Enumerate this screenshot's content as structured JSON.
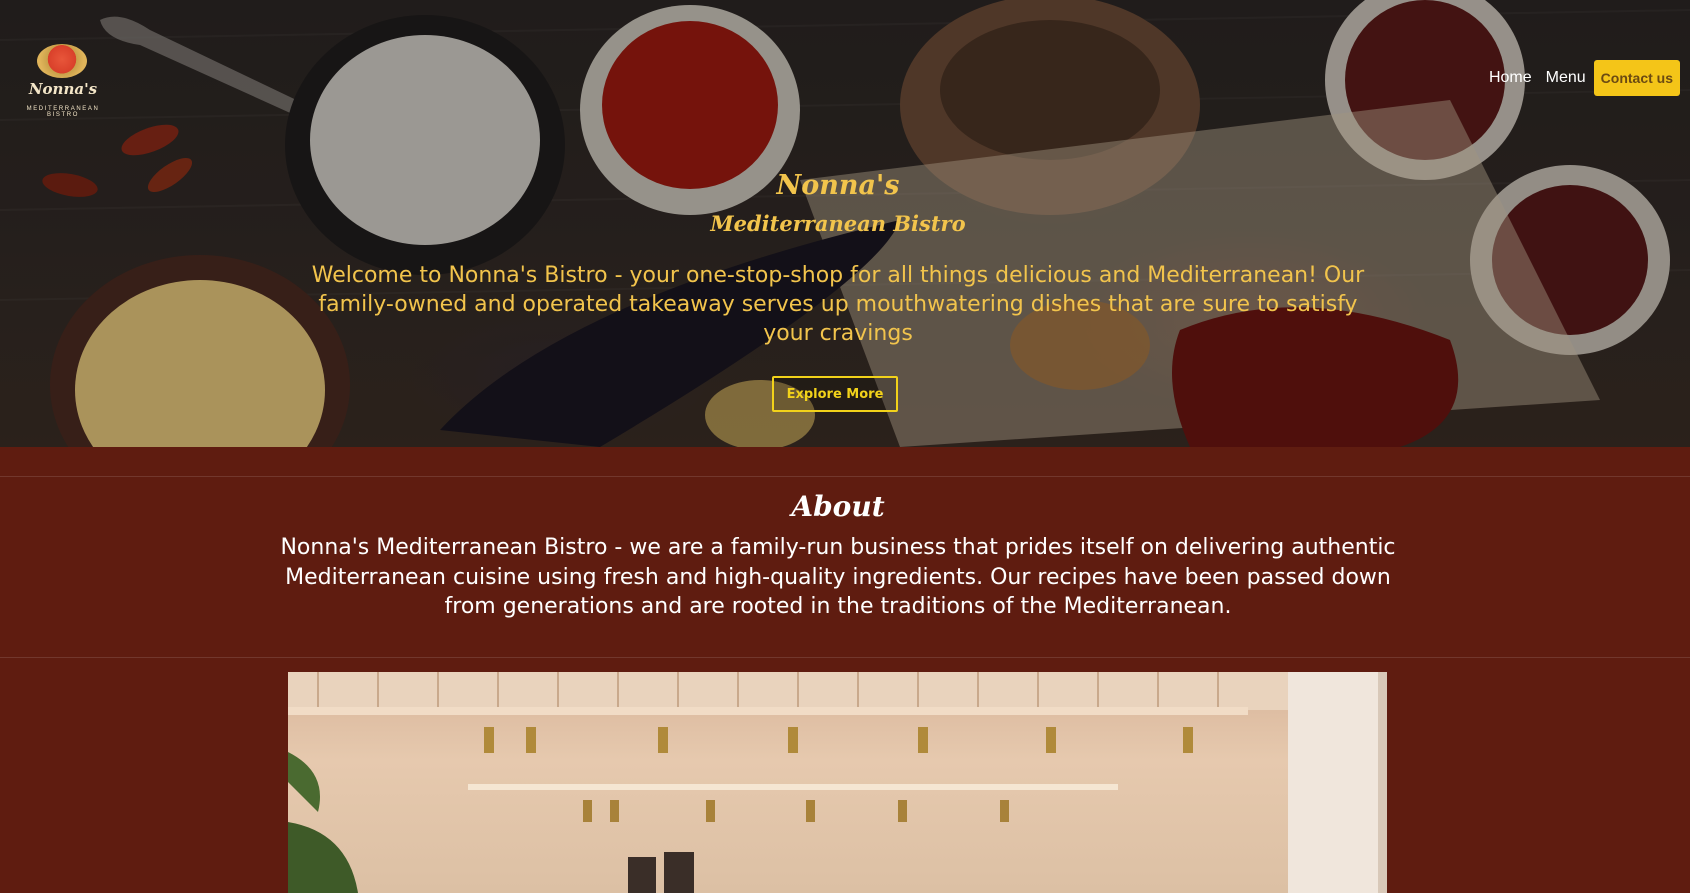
{
  "logo": {
    "name": "Nonna's",
    "sub": "MEDITERRANEAN BISTRO"
  },
  "nav": {
    "home": "Home",
    "menu": "Menu",
    "contact": "Contact us"
  },
  "hero": {
    "title": "Nonna's",
    "subtitle": "Mediterranean Bistro",
    "text": "Welcome to Nonna's Bistro - your one-stop-shop for all things delicious and Mediterranean! Our family-owned and operated takeaway serves up mouthwatering dishes that are sure to satisfy your cravings",
    "button": "Explore More"
  },
  "about": {
    "title": "About",
    "text": "Nonna's Mediterranean Bistro - we are a family-run business that prides itself on delivering authentic Mediterranean cuisine using fresh and high-quality ingredients. Our recipes have been passed down from generations and are rooted in the traditions of the Mediterranean."
  },
  "colors": {
    "page_bg": "#5f1c10",
    "accent_gold": "#f2c44c",
    "button_yellow": "#f4c518"
  }
}
